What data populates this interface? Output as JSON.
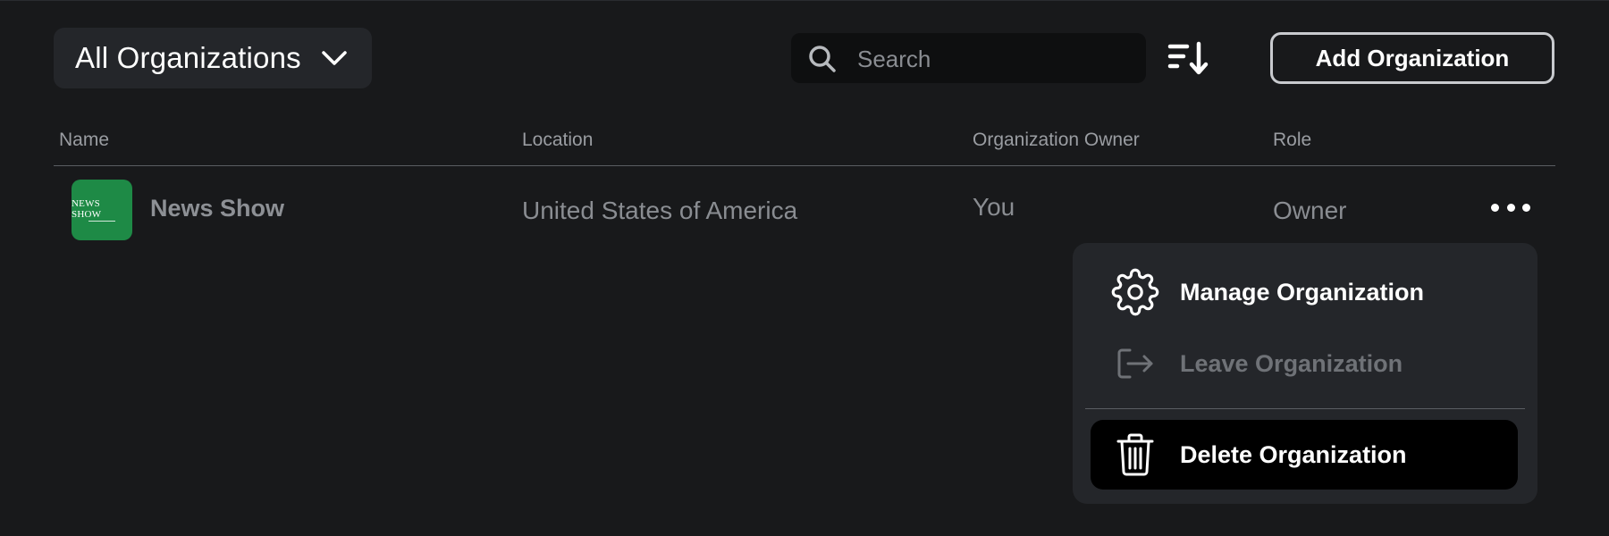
{
  "toolbar": {
    "org_filter_label": "All Organizations",
    "search_placeholder": "Search",
    "search_value": "",
    "add_button_label": "Add Organization"
  },
  "table": {
    "columns": [
      "Name",
      "Location",
      "Organization Owner",
      "Role"
    ],
    "rows": [
      {
        "logo_text": "NEWS SHOW",
        "name": "News Show",
        "location": "United States of America",
        "owner": "You",
        "role": "Owner"
      }
    ]
  },
  "row_menu": {
    "items": [
      {
        "label": "Manage Organization",
        "icon": "gear-icon",
        "enabled": true
      },
      {
        "label": "Leave Organization",
        "icon": "exit-icon",
        "enabled": false
      },
      {
        "label": "Delete Organization",
        "icon": "trash-icon",
        "enabled": true,
        "highlighted": true
      }
    ]
  },
  "colors": {
    "background": "#18191b",
    "surface": "#24262a",
    "logo_green": "#1e8a46",
    "muted_text": "#8a8d92"
  }
}
